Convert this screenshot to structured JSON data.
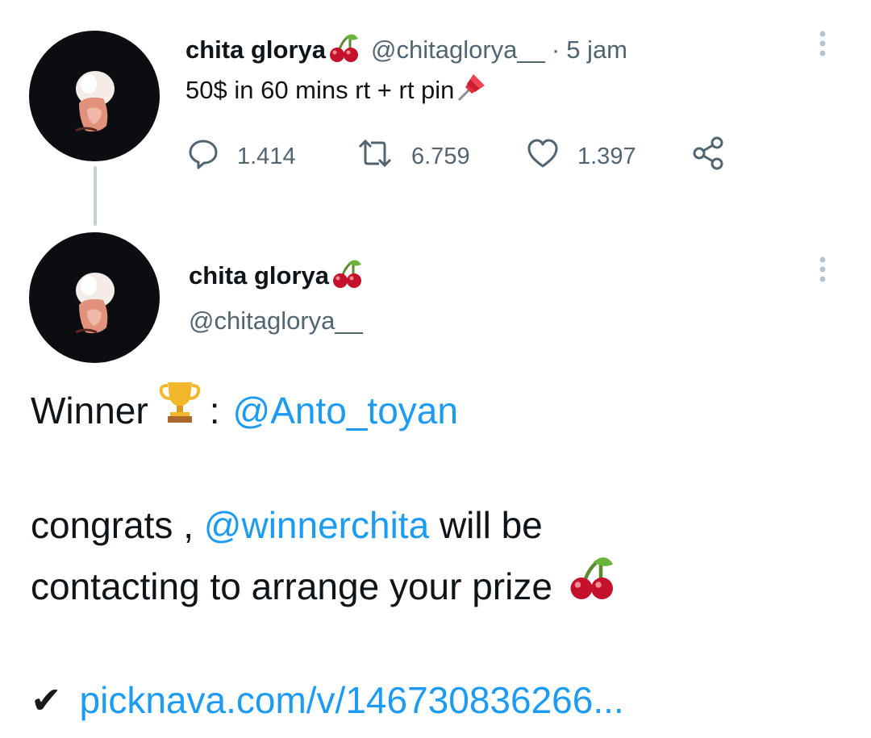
{
  "tweet1": {
    "name": "chita glorya",
    "handle": "@chitaglorya__",
    "separator": "·",
    "time": "5 jam",
    "text": "50$ in 60 mins rt + rt pin",
    "reply_count": "1.414",
    "retweet_count": "6.759",
    "like_count": "1.397"
  },
  "tweet2": {
    "name": "chita glorya",
    "handle": "@chitaglorya__",
    "winner_label": "Winner",
    "winner_colon": ":",
    "winner_mention": "@Anto_toyan",
    "congrats_prefix": "congrats ,",
    "congrats_mention": "@winnerchita",
    "congrats_suffix": "will be",
    "line3_text": "contacting to arrange your prize",
    "check_mark": "✔",
    "link_text": "picknava.com/v/146730836266..."
  },
  "icons": {
    "name_emoji": "cherries-icon",
    "pin_emoji": "pushpin-icon",
    "trophy_emoji": "trophy-icon",
    "reply": "reply-icon",
    "retweet": "retweet-icon",
    "like": "heart-icon",
    "share": "share-icon",
    "more": "more-vertical-icon"
  },
  "colors": {
    "link": "#1d9bf0",
    "secondary_text": "#536471",
    "thread_line": "#c4cfd6"
  }
}
